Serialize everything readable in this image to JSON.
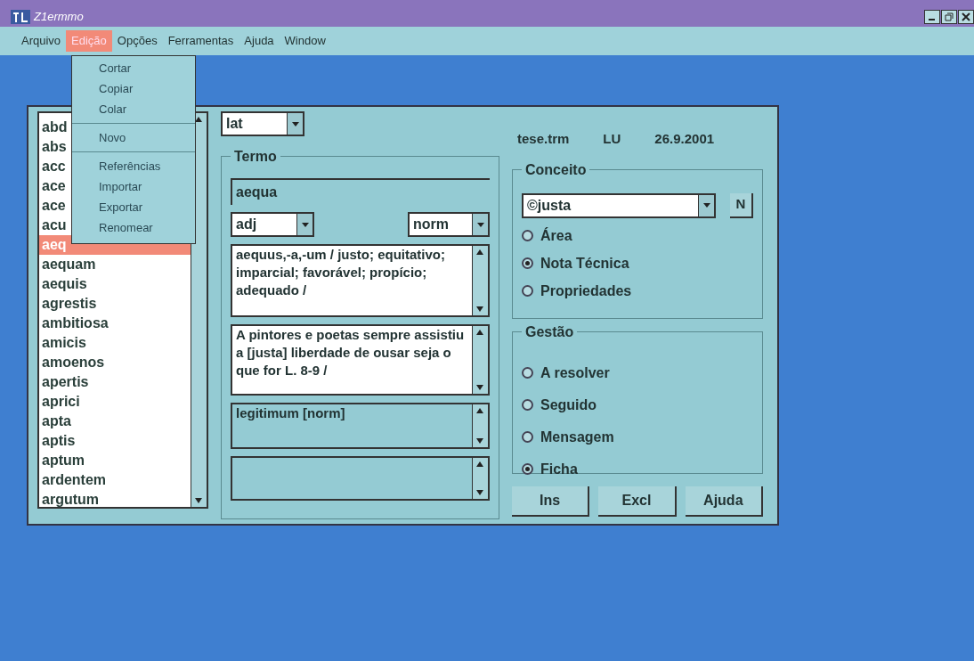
{
  "window": {
    "title": "Z1ermmo"
  },
  "menu_bar": [
    {
      "label": "Arquivo",
      "selected": false
    },
    {
      "label": "Edição",
      "selected": true
    },
    {
      "label": "Opções",
      "selected": false
    },
    {
      "label": "Ferramentas",
      "selected": false
    },
    {
      "label": "Ajuda",
      "selected": false
    },
    {
      "label": "Window",
      "selected": false
    }
  ],
  "edit_menu": {
    "groups": [
      [
        "Cortar",
        "Copiar",
        "Colar"
      ],
      [
        "Novo"
      ],
      [
        "Referências",
        "Importar",
        "Exportar",
        "Renomear"
      ]
    ]
  },
  "word_list": [
    {
      "label": "abd",
      "selected": false
    },
    {
      "label": "abs",
      "selected": false
    },
    {
      "label": "acc",
      "selected": false
    },
    {
      "label": "ace",
      "selected": false
    },
    {
      "label": "ace",
      "selected": false
    },
    {
      "label": "acu",
      "selected": false
    },
    {
      "label": "aeq",
      "selected": true
    },
    {
      "label": "aequam",
      "selected": false
    },
    {
      "label": "aequis",
      "selected": false
    },
    {
      "label": "agrestis",
      "selected": false
    },
    {
      "label": "ambitiosa",
      "selected": false
    },
    {
      "label": "amicis",
      "selected": false
    },
    {
      "label": "amoenos",
      "selected": false
    },
    {
      "label": "apertis",
      "selected": false
    },
    {
      "label": "aprici",
      "selected": false
    },
    {
      "label": "apta",
      "selected": false
    },
    {
      "label": "aptis",
      "selected": false
    },
    {
      "label": "aptum",
      "selected": false
    },
    {
      "label": "ardentem",
      "selected": false
    },
    {
      "label": "argutum",
      "selected": false
    }
  ],
  "language_select": "lat",
  "header": {
    "file": "tese.trm",
    "user": "LU",
    "date": "26.9.2001"
  },
  "termo": {
    "title": "Termo",
    "term": "aequa",
    "class_select": "adj",
    "status_select": "norm",
    "definition": "aequus,-a,-um / justo; equitativo; imparcial; favorável; propício; adequado /",
    "context": "A pintores e  poetas sempre assistiu a [justa] liberdade de ousar seja o que for L. 8-9  /",
    "synonyms": "legitimum [norm]"
  },
  "conceito": {
    "title": "Conceito",
    "concept_select": "©justa",
    "new_button": "N",
    "options": [
      {
        "label": "Área",
        "selected": false
      },
      {
        "label": "Nota Técnica",
        "selected": true
      },
      {
        "label": "Propriedades",
        "selected": false
      }
    ]
  },
  "gestao": {
    "title": "Gestão",
    "options": [
      {
        "label": "A resolver",
        "selected": false
      },
      {
        "label": "Seguido",
        "selected": false
      },
      {
        "label": "Mensagem",
        "selected": false
      },
      {
        "label": "Ficha",
        "selected": true
      }
    ]
  },
  "buttons": [
    "Ins",
    "Excl",
    "Ajuda"
  ]
}
